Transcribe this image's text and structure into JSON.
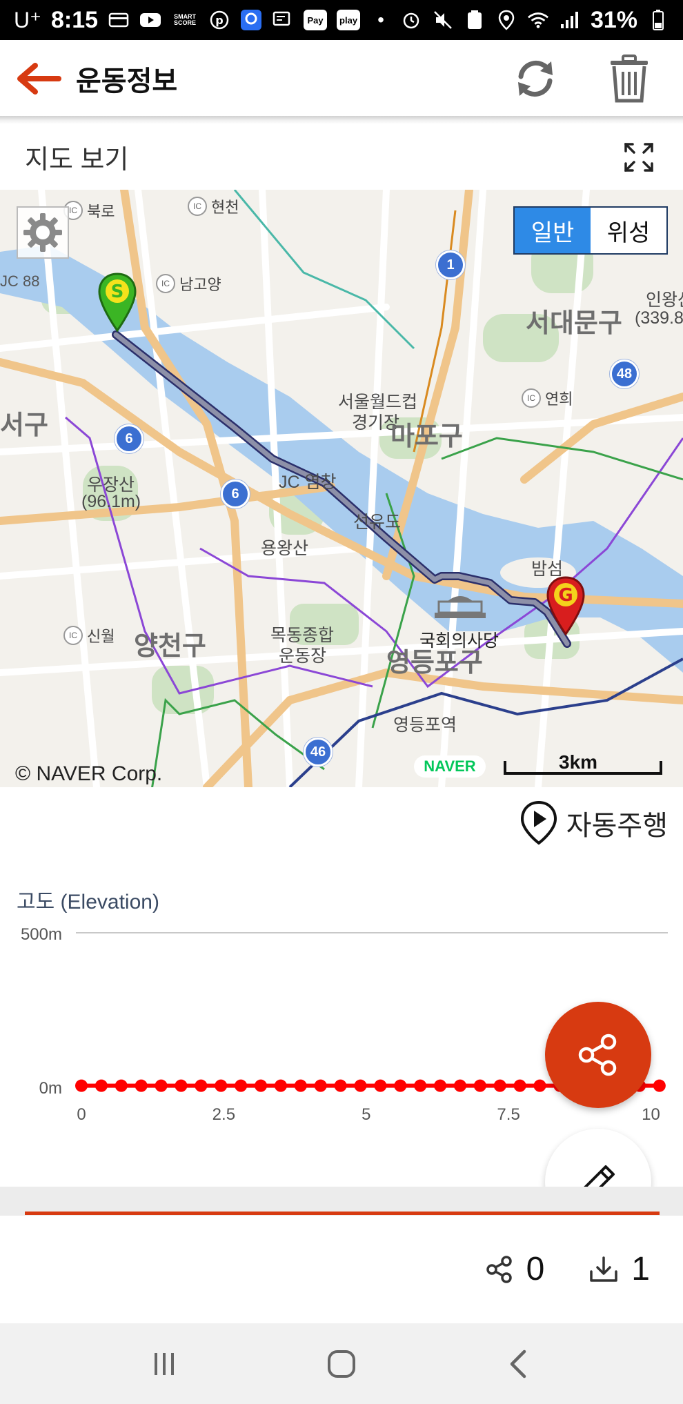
{
  "status_bar": {
    "carrier": "U⁺",
    "time": "8:15",
    "battery": "31%",
    "badges": [
      "SMART SCORE",
      "Pay",
      "play"
    ]
  },
  "header": {
    "title": "운동정보"
  },
  "map_section": {
    "label": "지도 보기",
    "map_type_normal": "일반",
    "map_type_satellite": "위성",
    "copyright": "© NAVER Corp.",
    "brand": "NAVER",
    "scale": "3km",
    "labels": {
      "bukro": "북로",
      "hyeoncheon": "현천",
      "namgoyang": "남고양",
      "jc88": "JC 88",
      "seodaemun": "서대문구",
      "inwangsan": "인왕산",
      "inwangsan_height": "(339.8",
      "worldcup": "서울월드컵",
      "stadium": "경기장",
      "mapo": "마포구",
      "yeonhui": "연희",
      "gangseo": "서구",
      "ujangsan": "우장산",
      "ujangsan_height": "(96.1m)",
      "jc_yeongchang": "JC 염창",
      "seonyudo": "선유도",
      "yongwangsan": "용왕산",
      "bamseom": "밤섬",
      "sinwol": "신월",
      "yangcheon": "양천구",
      "mokdong1": "목동종합",
      "mokdong2": "운동장",
      "assembly": "국회의사당",
      "yeongdeungpo": "영등포구",
      "yeongdeungpo_station": "영등포역",
      "road_1": "1",
      "road_48": "48",
      "road_6a": "6",
      "road_6b": "6",
      "road_46": "46",
      "ic": "IC"
    }
  },
  "autoplay": {
    "label": "자동주행"
  },
  "chart_data": {
    "type": "line",
    "title": "고도 (Elevation)",
    "ylim": [
      0,
      500
    ],
    "y_ticks": [
      "500m",
      "0m"
    ],
    "xlim": [
      0,
      10.2
    ],
    "x_ticks": [
      "0",
      "2.5",
      "5",
      "7.5",
      "10"
    ],
    "series": [
      {
        "color": "#ff0000",
        "x": [
          0,
          0.35,
          0.7,
          1.05,
          1.4,
          1.75,
          2.1,
          2.45,
          2.8,
          3.15,
          3.5,
          3.85,
          4.2,
          4.55,
          4.9,
          5.25,
          5.6,
          5.95,
          6.3,
          6.65,
          7.0,
          7.35,
          7.7,
          8.05,
          8.4,
          8.75,
          9.1,
          9.45,
          9.8,
          10.15
        ],
        "values": [
          3,
          3,
          3,
          3,
          3,
          3,
          3,
          3,
          3,
          3,
          3,
          3,
          3,
          3,
          3,
          3,
          3,
          3,
          3,
          3,
          3,
          3,
          3,
          3,
          3,
          3,
          3,
          3,
          3,
          3
        ]
      }
    ]
  },
  "stats": {
    "shares": "0",
    "downloads": "1"
  },
  "colors": {
    "accent": "#d73a11",
    "map_type_active": "#2e8ae6",
    "route": "#5a5f8a",
    "river": "#a9ccee"
  },
  "icons": {
    "back": "arrow-left-icon",
    "refresh": "refresh-icon",
    "delete": "trash-icon",
    "expand": "expand-icon",
    "settings": "gear-icon",
    "autoplay": "play-pin-icon",
    "share": "share-icon",
    "edit": "pencil-icon",
    "download": "download-icon"
  }
}
